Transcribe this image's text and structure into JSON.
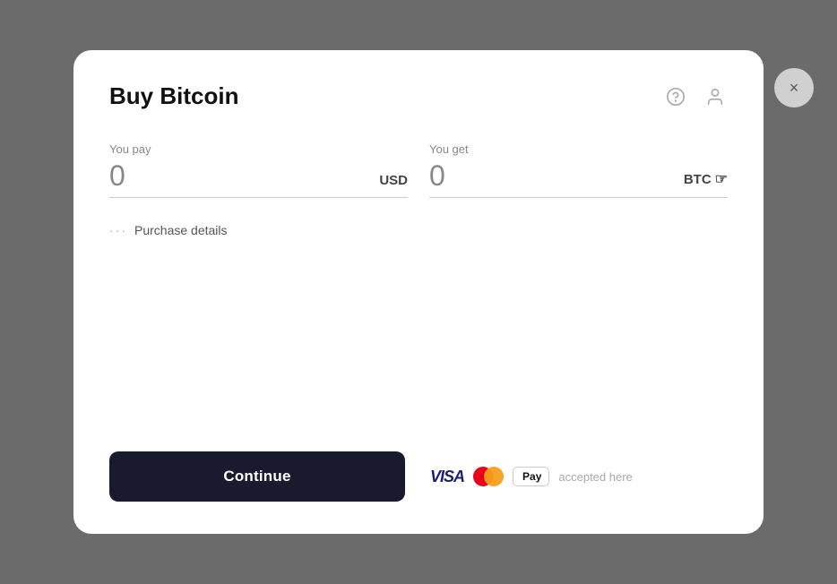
{
  "modal": {
    "title": "Buy Bitcoin",
    "close_button_label": "×",
    "help_icon": "?",
    "user_icon": "person"
  },
  "pay_field": {
    "label": "You pay",
    "value": "0",
    "currency": "USD"
  },
  "get_field": {
    "label": "You get",
    "value": "0",
    "currency": "BTC",
    "cursor": "☞"
  },
  "purchase_details": {
    "dots": "···",
    "label": "Purchase details"
  },
  "footer": {
    "continue_label": "Continue",
    "visa_label": "VISA",
    "applepay_label": "Pay",
    "apple_symbol": "",
    "accepted_label": "accepted here"
  }
}
